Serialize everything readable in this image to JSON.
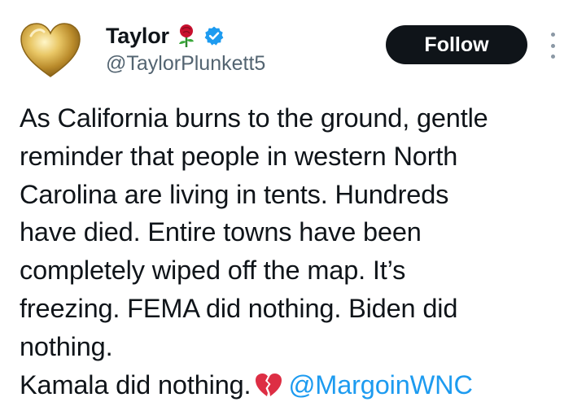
{
  "author": {
    "display_name": "Taylor",
    "handle": "@TaylorPlunkett5",
    "name_emoji": "rose-icon",
    "verified": true,
    "avatar_icon": "gold-heart-icon"
  },
  "actions": {
    "follow_label": "Follow",
    "more_icon": "more-options-icon"
  },
  "tweet": {
    "lines": [
      "As California burns to the ground, gentle",
      "reminder that people in western North",
      "Carolina are living in tents. Hundreds",
      "have died. Entire towns have been",
      "completely wiped off the map. It’s",
      "freezing. FEMA did nothing. Biden did",
      "nothing."
    ],
    "last_line_text": "Kamala did nothing.",
    "last_line_emoji": "broken-heart-icon",
    "mention": "@MargoinWNC"
  },
  "colors": {
    "text": "#0f1419",
    "secondary": "#536471",
    "link": "#1d9bf0",
    "follow_bg": "#0f1419",
    "verified": "#1d9bf0"
  }
}
